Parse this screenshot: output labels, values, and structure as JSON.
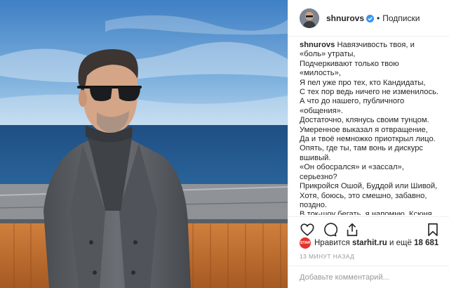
{
  "colors": {
    "verified_badge": "#3897f0",
    "link_text": "#262626",
    "muted_text": "#999999",
    "divider": "#efefef",
    "liker_avatar": "#e4322b"
  },
  "photo": {
    "subject": "man in sunglasses and grey coat by the sea"
  },
  "header": {
    "username": "shnurovs",
    "verified_icon": "verified-badge-icon",
    "separator": "•",
    "follow_label": "Подписки"
  },
  "caption": {
    "username": "shnurovs",
    "text": "Навязчивость твоя, и «боль» утраты,\nПодчеркивают только твою «милость»,\nЯ пел уже про тех, кто Кандидаты,\nС тех пор ведь ничего не изменилось.\nА что до нашего, публичного «общения».\nДостаточно, клянусь своим тунцом.\nУмеренное выказал я отвращение,\nДа и твоё немножко приоткрыл лицо.\nОпять, где ты, там вонь и дискурс вшивый.\n«Он обосрался» и «зассал», серьезно?\nПрикройся Ошой, Буддой или Шивой,\nХотя, боюсь, это смешно, забавно, поздно.\nВ ток-шоу бегать, я напомню, Ксюня\nТвоя привычка, может быть приём,\nИ распускать там крокодильим слюни."
  },
  "actions": {
    "like_icon": "heart-icon",
    "comment_icon": "comment-icon",
    "share_icon": "share-icon",
    "save_icon": "bookmark-icon"
  },
  "likes": {
    "avatar_text": "STAR",
    "prefix": "Нравится",
    "liker": "starhit.ru",
    "middle": "и ещё",
    "count": "18 681"
  },
  "timestamp": "13 МИНУТ НАЗАД",
  "comment": {
    "placeholder": "Добавьте комментарий..."
  }
}
